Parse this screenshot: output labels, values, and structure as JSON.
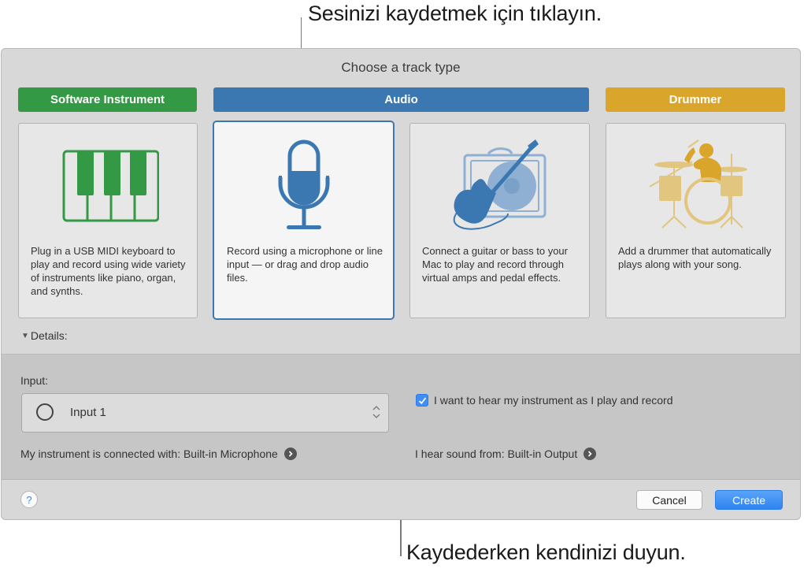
{
  "callouts": {
    "top": "Sesinizi kaydetmek için tıklayın.",
    "bottom": "Kaydederken kendinizi duyun."
  },
  "dialog": {
    "title": "Choose a track type",
    "track_types": [
      {
        "label": "Software Instrument",
        "color": "#339944",
        "icon": "piano-keys-icon",
        "description": "Plug in a USB MIDI keyboard to play and record using wide variety of instruments like piano, organ, and synths."
      },
      {
        "label": "Audio",
        "color": "#3b78b2",
        "icon": "microphone-icon",
        "selected": true,
        "description": "Record using a microphone or line input — or drag and drop audio files."
      },
      {
        "label": "",
        "color": "#3b78b2",
        "icon": "guitar-amp-icon",
        "description": "Connect a guitar or bass to your Mac to play and record through virtual amps and pedal effects."
      },
      {
        "label": "Drummer",
        "color": "#d9a52b",
        "icon": "drummer-icon",
        "description": "Add a drummer that automatically plays along with your song."
      }
    ],
    "details": {
      "toggle_label": "Details:",
      "input_label": "Input:",
      "input_value": "Input 1",
      "monitor_checkbox": {
        "label": "I want to hear my instrument as I play and record",
        "checked": true
      },
      "instrument_connection": "My instrument is connected with: Built-in Microphone",
      "output": "I hear sound from: Built-in Output"
    },
    "footer": {
      "help_label": "?",
      "cancel_label": "Cancel",
      "create_label": "Create"
    }
  }
}
